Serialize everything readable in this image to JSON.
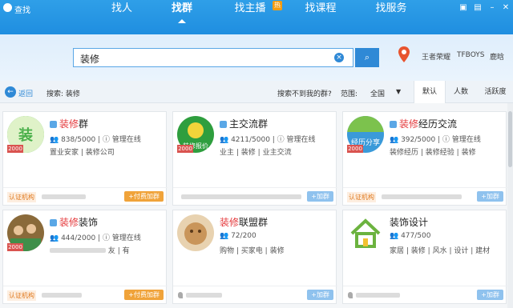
{
  "window": {
    "title": "查找"
  },
  "nav": {
    "items": [
      {
        "label": "找人"
      },
      {
        "label": "找群"
      },
      {
        "label": "找主播",
        "badge": "热"
      },
      {
        "label": "找课程"
      },
      {
        "label": "找服务"
      }
    ],
    "active_index": 1
  },
  "search": {
    "value": "装修",
    "clear_icon": "×",
    "search_icon": "⌕"
  },
  "location": {
    "icon": "map-pin-icon"
  },
  "hot_words": [
    "王者荣耀",
    "TFBOYS",
    "鹿晗"
  ],
  "filterbar": {
    "back_label": "返回",
    "search_summary": "搜索: 装修",
    "cant_find_link": "搜索不到我的群?",
    "range_label": "范围:",
    "range_value": "全国",
    "sort_tabs": [
      "默认",
      "人数",
      "活跃度"
    ],
    "sort_active": 0
  },
  "cards": [
    {
      "name_pre": "",
      "name_hl": "装修",
      "name_post": "群",
      "members": "838/5000",
      "manage": "管理在线",
      "tags": [
        "置业安家",
        "",
        "装修公司",
        ""
      ],
      "badge": "2000",
      "cert": "认证机构",
      "join": "+付费加群",
      "paid": true,
      "avatar_color": "#4bb04b"
    },
    {
      "name_pre": "",
      "name_hl": "",
      "name_post": "主交流群",
      "members": "4211/5000",
      "manage": "管理在线",
      "tags": [
        "业主",
        "",
        "装修",
        "业主交流"
      ],
      "badge": "2000",
      "cert": "",
      "join": "+加群",
      "paid": false,
      "avatar_color": "#2e9e3e",
      "avatar_text": "装修报价"
    },
    {
      "name_pre": "",
      "name_hl": "装修",
      "name_post": "经历交流",
      "members": "392/5000",
      "manage": "管理在线",
      "tags": [
        "",
        "装修经历",
        "装修经验",
        "装修"
      ],
      "badge": "2000",
      "cert": "认证机构",
      "join": "+加群",
      "paid": false,
      "avatar_color": "#3a9ad9",
      "avatar_text": "经历分享"
    },
    {
      "name_pre": "",
      "name_hl": "装修",
      "name_post": "装饰",
      "members": "444/2000",
      "manage": "管理在线",
      "tags": [
        "",
        "",
        "友",
        "有"
      ],
      "badge": "2000",
      "cert": "认证机构",
      "join": "+付费加群",
      "paid": true,
      "avatar_color": "#b07a3a"
    },
    {
      "name_pre": "",
      "name_hl": "装修",
      "name_post": "联盟群",
      "members": "72/200",
      "manage": "",
      "tags": [
        "购物",
        "买家电",
        "装修"
      ],
      "badge": "",
      "cert": "",
      "join": "+加群",
      "paid": false,
      "avatar_color": "#c9955a"
    },
    {
      "name_pre": "",
      "name_hl": "",
      "name_post": "装饰设计",
      "members": "477/500",
      "manage": "",
      "tags": [
        "家居",
        "装修",
        "风水",
        "设计",
        "建材"
      ],
      "badge": "",
      "cert": "",
      "join": "+加群",
      "paid": false,
      "avatar_color": "#ffffff",
      "avatar_icon": "house-icon"
    }
  ],
  "colors": {
    "accent": "#1f8ee0",
    "highlight": "#e4393c",
    "paid": "#f0a33a",
    "free": "#8fc2ee"
  }
}
